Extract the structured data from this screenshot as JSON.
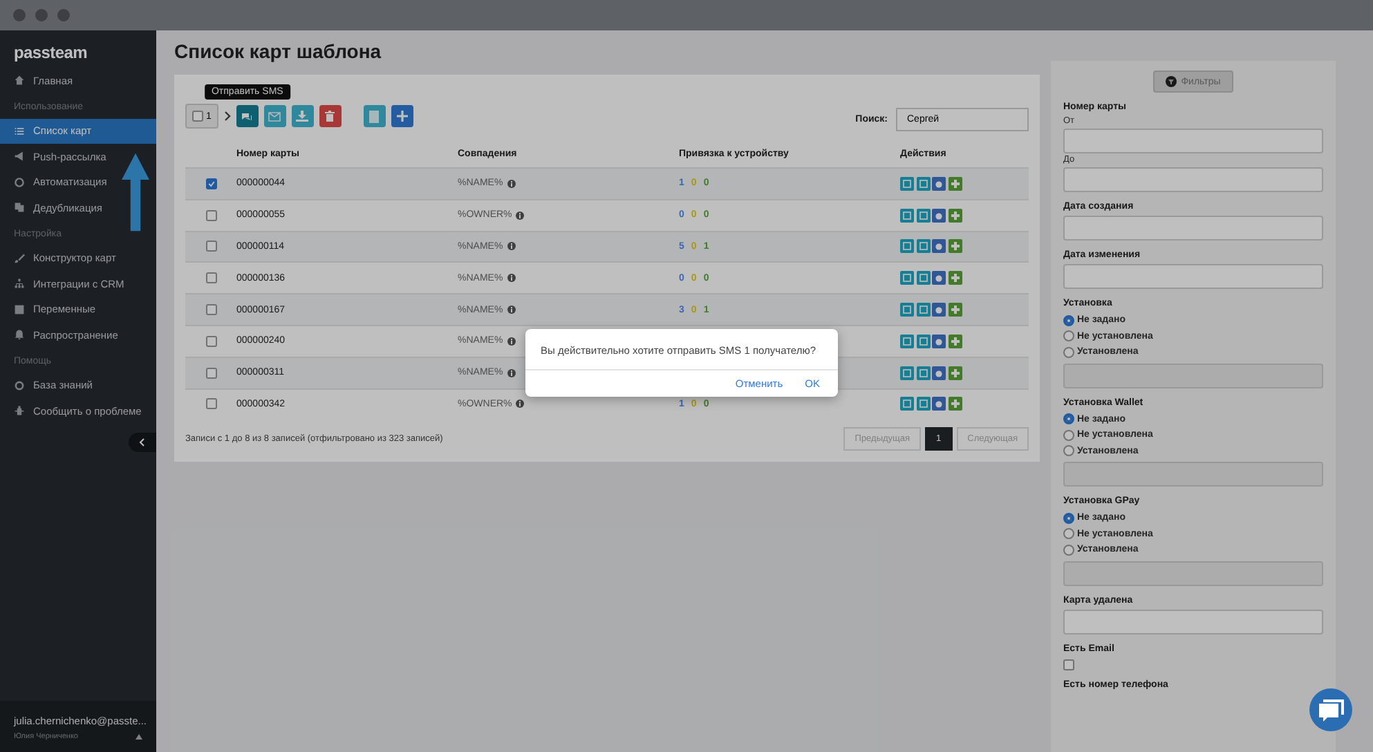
{
  "sidebar": {
    "logo": "passteam",
    "items": [
      {
        "kind": "item",
        "label": "Главная",
        "selected": false
      },
      {
        "kind": "section",
        "label": "Использование"
      },
      {
        "kind": "item",
        "label": "Список карт",
        "selected": true
      },
      {
        "kind": "item",
        "label": "Push-рассылка",
        "selected": false
      },
      {
        "kind": "item",
        "label": "Автоматизация",
        "selected": false
      },
      {
        "kind": "item",
        "label": "Дедубликация",
        "selected": false
      },
      {
        "kind": "section",
        "label": "Настройка"
      },
      {
        "kind": "item",
        "label": "Конструктор карт",
        "selected": false
      },
      {
        "kind": "item",
        "label": "Интеграции с CRM",
        "selected": false
      },
      {
        "kind": "item",
        "label": "Переменные",
        "selected": false
      },
      {
        "kind": "item",
        "label": "Распространение",
        "selected": false
      },
      {
        "kind": "section",
        "label": "Помощь"
      },
      {
        "kind": "item",
        "label": "База знаний",
        "selected": false
      },
      {
        "kind": "item",
        "label": "Сообщить о проблеме",
        "selected": false
      }
    ],
    "user": {
      "email": "julia.chernichenko@passte...",
      "name": "Юлия Черниченко"
    }
  },
  "page": {
    "title": "Список карт шаблона"
  },
  "toolbar": {
    "selected_count": "1",
    "tooltip": "Отправить SMS",
    "search_label": "Поиск:",
    "search_value": "Сергей"
  },
  "table": {
    "columns": [
      "Номер карты",
      "Совпадения",
      "Привязка к устройству",
      "Действия"
    ],
    "rows": [
      {
        "checked": true,
        "number": "000000044",
        "match": "%NAME%",
        "bindings": [
          {
            "value": "1",
            "color": "#3b67b8"
          },
          {
            "value": "0",
            "color": "#a89a0a"
          },
          {
            "value": "0",
            "color": "#3f7e23"
          }
        ]
      },
      {
        "checked": false,
        "number": "000000055",
        "match": "%OWNER%",
        "bindings": [
          {
            "value": "0",
            "color": "#3b67b8"
          },
          {
            "value": "0",
            "color": "#a89a0a"
          },
          {
            "value": "0",
            "color": "#3f7e23"
          }
        ]
      },
      {
        "checked": false,
        "number": "000000114",
        "match": "%NAME%",
        "bindings": [
          {
            "value": "5",
            "color": "#3b67b8"
          },
          {
            "value": "0",
            "color": "#a89a0a"
          },
          {
            "value": "1",
            "color": "#3f7e23"
          }
        ]
      },
      {
        "checked": false,
        "number": "000000136",
        "match": "%NAME%",
        "bindings": [
          {
            "value": "0",
            "color": "#3b67b8"
          },
          {
            "value": "0",
            "color": "#a89a0a"
          },
          {
            "value": "0",
            "color": "#3f7e23"
          }
        ]
      },
      {
        "checked": false,
        "number": "000000167",
        "match": "%NAME%",
        "bindings": [
          {
            "value": "3",
            "color": "#3b67b8"
          },
          {
            "value": "0",
            "color": "#a89a0a"
          },
          {
            "value": "1",
            "color": "#3f7e23"
          }
        ]
      },
      {
        "checked": false,
        "number": "000000240",
        "match": "%NAME%"
      },
      {
        "checked": false,
        "number": "000000311",
        "match": "%NAME%"
      },
      {
        "checked": false,
        "number": "000000342",
        "match": "%OWNER%",
        "bindings": [
          {
            "value": "1",
            "color": "#3b67b8"
          },
          {
            "value": "0",
            "color": "#a89a0a"
          },
          {
            "value": "0",
            "color": "#3f7e23"
          }
        ]
      }
    ]
  },
  "footer": {
    "info": "Записи с 1 до 8 из 8 записей (отфильтровано из 323 записей)",
    "pages": [
      {
        "label": "Предыдущая",
        "kind": "nav"
      },
      {
        "label": "1",
        "kind": "page",
        "selected": true
      },
      {
        "label": "Следующая",
        "kind": "nav"
      }
    ]
  },
  "filters": {
    "button": "Фильтры",
    "groups": [
      {
        "kind": "range",
        "label": "Номер карты",
        "from": "От",
        "to": "До"
      },
      {
        "kind": "input",
        "label": "Дата создания"
      },
      {
        "kind": "input",
        "label": "Дата изменения"
      },
      {
        "kind": "radio",
        "label": "Установка",
        "options": [
          {
            "label": "Не задано",
            "selected": true
          },
          {
            "label": "Не установлена",
            "selected": false
          },
          {
            "label": "Установлена",
            "selected": false
          }
        ]
      },
      {
        "kind": "radio",
        "label": "Установка Wallet",
        "options": [
          {
            "label": "Не задано",
            "selected": true
          },
          {
            "label": "Не установлена",
            "selected": false
          },
          {
            "label": "Установлена",
            "selected": false
          }
        ]
      },
      {
        "kind": "radio",
        "label": "Установка GPay",
        "options": [
          {
            "label": "Не задано",
            "selected": true
          },
          {
            "label": "Не установлена",
            "selected": false
          },
          {
            "label": "Установлена",
            "selected": false
          }
        ]
      },
      {
        "kind": "input",
        "label": "Карта удалена"
      },
      {
        "kind": "checkbox",
        "label": "Есть Email",
        "checked": false
      },
      {
        "kind": "label",
        "label": "Есть номер телефона"
      }
    ]
  },
  "dialog": {
    "message": "Вы действительно хотите отправить SMS 1 получателю?",
    "buttons": [
      "Отменить",
      "OK"
    ]
  }
}
